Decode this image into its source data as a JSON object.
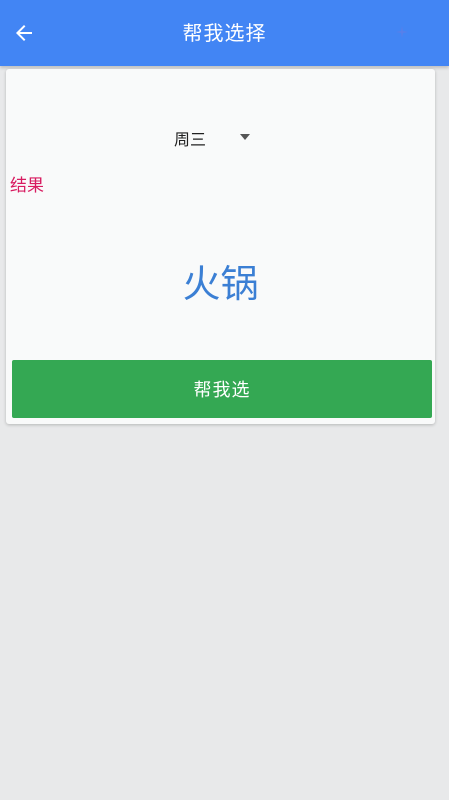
{
  "appbar": {
    "title": "帮我选择",
    "back_icon": "arrow-left-icon",
    "action_icon": "sparkle-icon",
    "background_color": "#4285f4"
  },
  "selector": {
    "selected_value": "周三",
    "caret_icon": "dropdown-caret-icon"
  },
  "result": {
    "label": "结果",
    "value": "火锅",
    "label_color": "#d81b60",
    "value_color": "#3b7fd4"
  },
  "action_button": {
    "label": "帮我选",
    "color": "#34a853"
  }
}
